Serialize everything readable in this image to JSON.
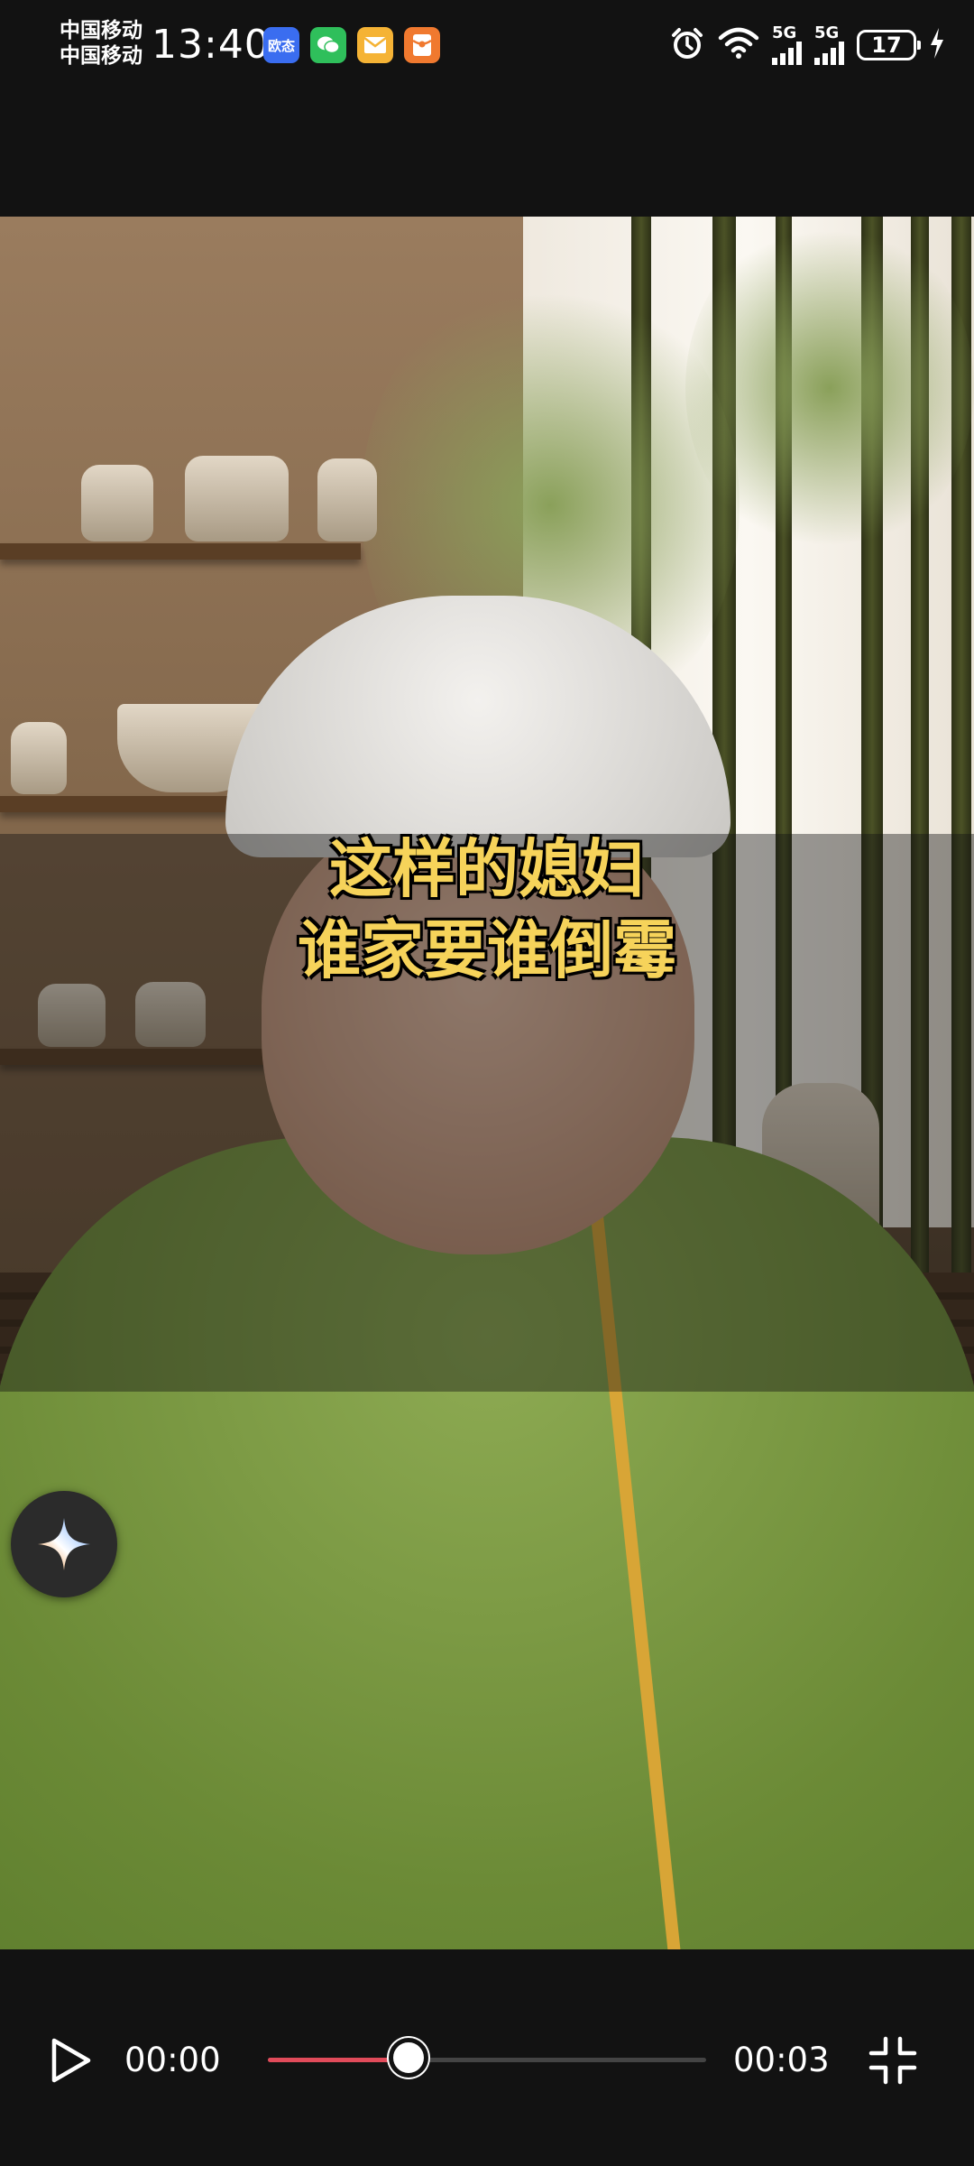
{
  "status_bar": {
    "carrier_1": "中国移动",
    "carrier_2": "中国移动",
    "time": "13:40",
    "app_badges": [
      {
        "name": "ouzao-app-icon",
        "label": "欧态",
        "color": "#3a6df0"
      },
      {
        "name": "wechat-icon",
        "color": "#2fbf5b"
      },
      {
        "name": "mail-icon",
        "color": "#f5b335"
      },
      {
        "name": "red-packet-icon",
        "color": "#f0792f"
      }
    ],
    "network_1": "5G",
    "network_2": "5G",
    "battery_level": "17"
  },
  "video": {
    "caption_line_1": "这样的媳妇",
    "caption_line_2": "谁家要谁倒霉",
    "caption_color": "#f6d35a"
  },
  "player": {
    "current_time": "00:00",
    "duration": "00:03",
    "progress_fraction": 0.32,
    "progress_color": "#e14b5a"
  }
}
